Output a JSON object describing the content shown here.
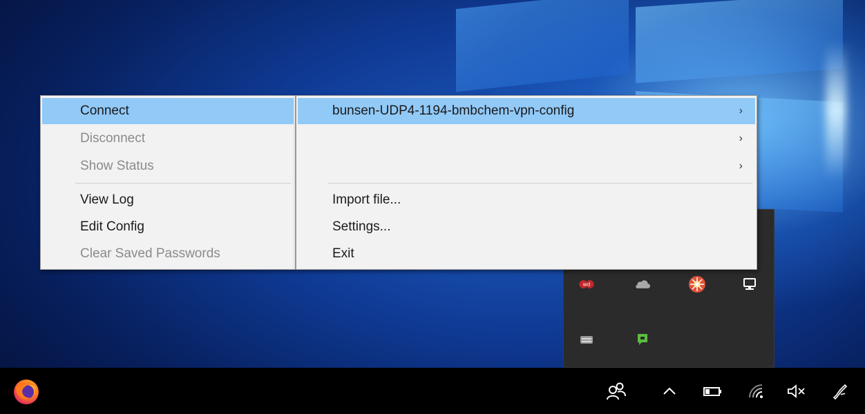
{
  "context_menu": {
    "items": [
      {
        "label": "Connect",
        "state": "highlighted"
      },
      {
        "label": "Disconnect",
        "state": "disabled"
      },
      {
        "label": "Show Status",
        "state": "disabled"
      },
      {
        "label": "View Log",
        "state": "enabled"
      },
      {
        "label": "Edit Config",
        "state": "enabled"
      },
      {
        "label": "Clear Saved Passwords",
        "state": "disabled"
      }
    ]
  },
  "submenu": {
    "items": [
      {
        "label": "bunsen-UDP4-1194-bmbchem-vpn-config",
        "has_submenu": true,
        "state": "highlighted"
      },
      {
        "label": "",
        "has_submenu": true
      },
      {
        "label": "",
        "has_submenu": true
      },
      {
        "label": "Import file...",
        "has_submenu": false
      },
      {
        "label": "Settings...",
        "has_submenu": false
      },
      {
        "label": "Exit",
        "has_submenu": false
      }
    ],
    "chevron": "›"
  },
  "tray_flyout": {
    "icons": [
      "wd-drive-icon",
      "onedrive-cloud-icon",
      "openvpn-gui-icon",
      "network-monitor-icon",
      "removable-drive-icon",
      "green-chat-icon"
    ]
  },
  "taskbar": {
    "apps": [
      "firefox-icon"
    ],
    "system": [
      "people-icon",
      "show-hidden-icons-chevron",
      "battery-icon",
      "wifi-icon",
      "volume-muted-icon",
      "pen-workspace-icon"
    ]
  },
  "colors": {
    "menu_bg": "#f2f2f2",
    "highlight": "#91c9f7",
    "disabled_text": "#8a8a8a",
    "taskbar_bg": "#000000"
  }
}
